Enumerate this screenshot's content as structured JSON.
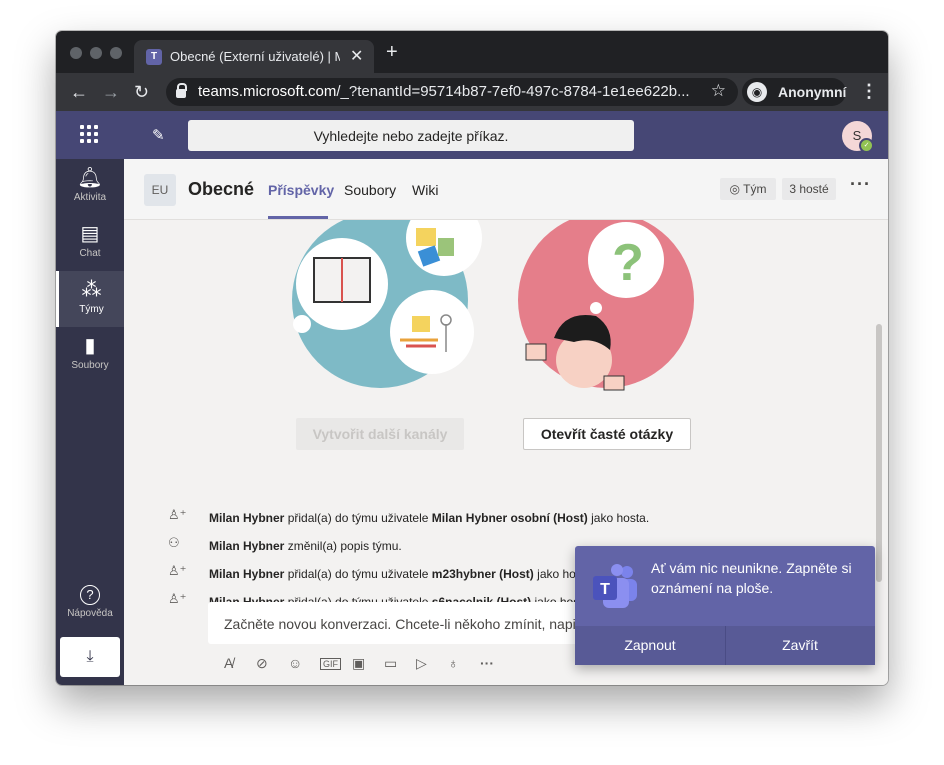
{
  "browser": {
    "tab_title": "Obecné (Externí uživatelé) | Mi",
    "tab_close": "✕",
    "new_tab": "+",
    "url_host": "teams.microsoft.com",
    "url_rest": "/_?tenantId=95714b87-7ef0-497c-8784-1e1ee622b...",
    "incognito_label": "Anonymní"
  },
  "teams_header": {
    "search_placeholder": "Vyhledejte nebo zadejte příkaz.",
    "avatar_initial": "S"
  },
  "rail": {
    "items": [
      {
        "label": "Aktivita",
        "icon": "bell-icon"
      },
      {
        "label": "Chat",
        "icon": "chat-icon"
      },
      {
        "label": "Týmy",
        "icon": "teams-icon"
      },
      {
        "label": "Soubory",
        "icon": "file-icon"
      }
    ],
    "help_label": "Nápověda"
  },
  "channel": {
    "badge": "EU",
    "name": "Obecné",
    "tabs": [
      "Příspěvky",
      "Soubory",
      "Wiki"
    ],
    "team_button": "Tým",
    "guests_button": "3 hosté"
  },
  "welcome": {
    "create_channels_button": "Vytvořit další kanály",
    "faq_button": "Otevřít časté otázky"
  },
  "activity": [
    {
      "actor": "Milan Hybner",
      "text": "přidal(a) do týmu uživatele",
      "target": "Milan Hybner osobní (Host)",
      "suffix": "jako hosta.",
      "icon": "add-user-icon"
    },
    {
      "actor": "Milan Hybner",
      "text": "změnil(a) popis týmu.",
      "target": "",
      "suffix": "",
      "icon": "team-icon"
    },
    {
      "actor": "Milan Hybner",
      "text": "přidal(a) do týmu uživatele",
      "target": "m23hybner (Host)",
      "suffix": "jako hosta.",
      "icon": "add-user-icon"
    },
    {
      "actor": "Milan Hybner",
      "text": "přidal(a) do týmu uživatele",
      "target": "s6nacelnik (Host)",
      "suffix": "jako hosta.",
      "icon": "add-user-icon"
    }
  ],
  "compose": {
    "placeholder": "Začněte novou konverzaci. Chcete-li někoho zmínit, napište @"
  },
  "toast": {
    "message": "Ať vám nic neunikne. Zapněte si oznámení na ploše.",
    "enable_button": "Zapnout",
    "close_button": "Zavřít"
  },
  "colors": {
    "brand": "#6264a7",
    "header": "#464775",
    "rail": "#33344a"
  }
}
